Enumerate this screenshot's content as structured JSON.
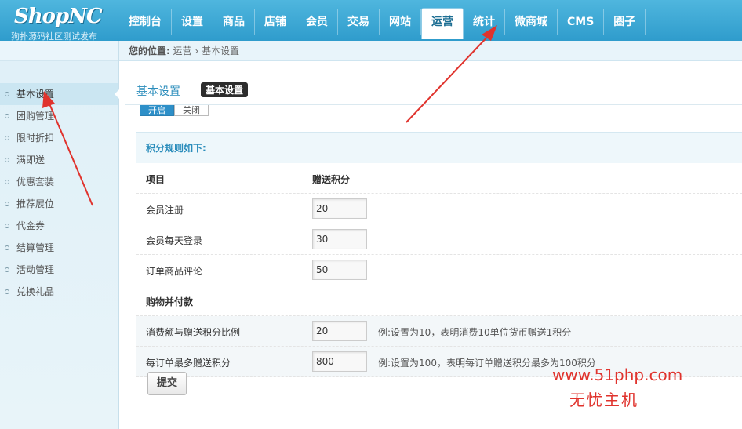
{
  "logo": {
    "brand": "Shop",
    "brand_accent": "NC",
    "subtitle": "狗扑源码社区测试发布"
  },
  "nav": [
    "控制台",
    "设置",
    "商品",
    "店铺",
    "会员",
    "交易",
    "网站",
    "运营",
    "统计",
    "微商城",
    "CMS",
    "圈子"
  ],
  "nav_active": "运营",
  "breadcrumb": {
    "prefix": "您的位置:",
    "path": "运营 › 基本设置"
  },
  "sidebar": {
    "items": [
      "基本设置",
      "团购管理",
      "限时折扣",
      "满即送",
      "优惠套装",
      "推荐展位",
      "代金券",
      "结算管理",
      "活动管理",
      "兑换礼品"
    ],
    "active": "基本设置"
  },
  "main": {
    "title": "基本设置",
    "tag": "基本设置",
    "toggle_on": "开启",
    "toggle_off": "关闭",
    "rules_heading": "积分规则如下:",
    "col_item": "项目",
    "col_points": "赠送积分",
    "rows": [
      {
        "label": "会员注册",
        "value": "20"
      },
      {
        "label": "会员每天登录",
        "value": "30"
      },
      {
        "label": "订单商品评论",
        "value": "50"
      }
    ],
    "section_title": "购物并付款",
    "rows2": [
      {
        "label": "消费额与赠送积分比例",
        "value": "20",
        "hint": "例:设置为10，表明消费10单位货币赠送1积分"
      },
      {
        "label": "每订单最多赠送积分",
        "value": "800",
        "hint": "例:设置为100，表明每订单赠送积分最多为100积分"
      }
    ],
    "submit_label": "提交"
  },
  "watermark": {
    "line1": "www.51php.com",
    "line2": "无忧主机"
  },
  "colors": {
    "header": "#3aa8d6",
    "accent": "#2a8cbb",
    "arrow": "#e0332d"
  }
}
